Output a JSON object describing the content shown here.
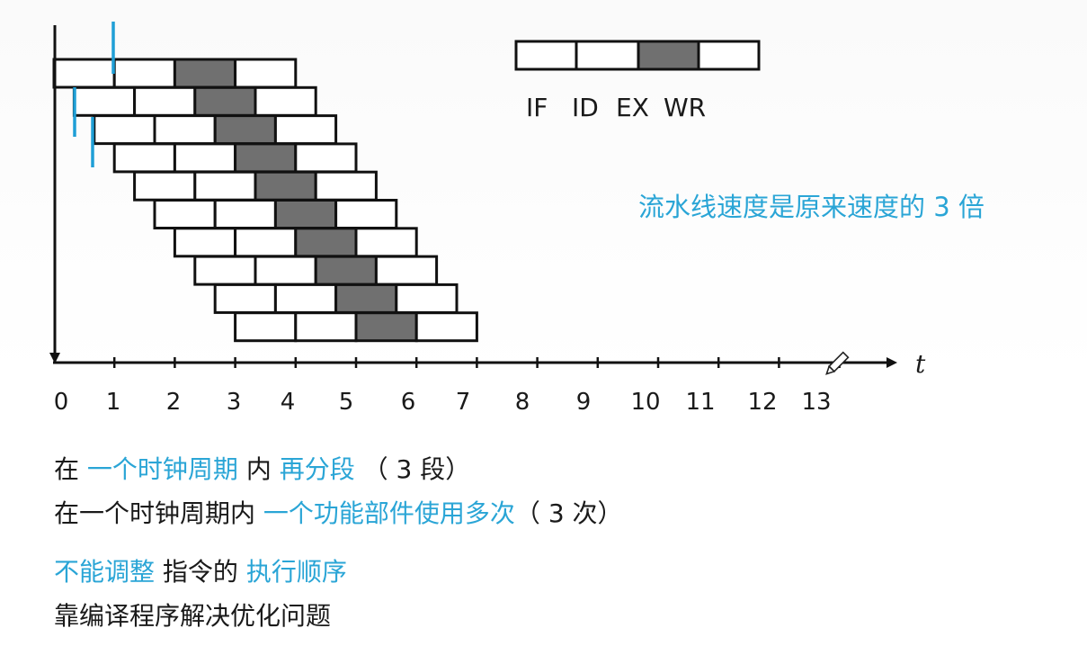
{
  "legend": {
    "stages": [
      "IF",
      "ID",
      "EX",
      "WR"
    ]
  },
  "axis": {
    "t_label": "t",
    "ticks": [
      "0",
      "1",
      "2",
      "3",
      "4",
      "5",
      "6",
      "7",
      "8",
      "9",
      "10",
      "11",
      "12",
      "13"
    ]
  },
  "pipeline": {
    "instruction_count": 10,
    "stages_per_instruction": 4,
    "highlighted_stage_index": 2,
    "stage_duration_cycles": 1,
    "issue_interval_cycles": 0.3333,
    "colors": {
      "empty": "#ffffff",
      "highlight": "#707070",
      "marker": "#1f9fd6"
    }
  },
  "note": {
    "text": "流水线速度是原来速度的 3 倍"
  },
  "lines": [
    {
      "segments": [
        {
          "text": "在 ",
          "hl": false
        },
        {
          "text": "一个时钟周期",
          "hl": true
        },
        {
          "text": " 内 ",
          "hl": false
        },
        {
          "text": "再分段",
          "hl": true
        },
        {
          "text": " （ 3 段）",
          "hl": false
        }
      ]
    },
    {
      "segments": [
        {
          "text": "在一个时钟周期内 ",
          "hl": false
        },
        {
          "text": "一个功能部件使用多次",
          "hl": true
        },
        {
          "text": "（ 3 次）",
          "hl": false
        }
      ]
    },
    {
      "segments": [
        {
          "text": "不能调整",
          "hl": true
        },
        {
          "text": " 指令的 ",
          "hl": false
        },
        {
          "text": "执行顺序",
          "hl": true
        }
      ]
    },
    {
      "segments": [
        {
          "text": "靠编译程序解决优化问题",
          "hl": false
        }
      ]
    }
  ]
}
